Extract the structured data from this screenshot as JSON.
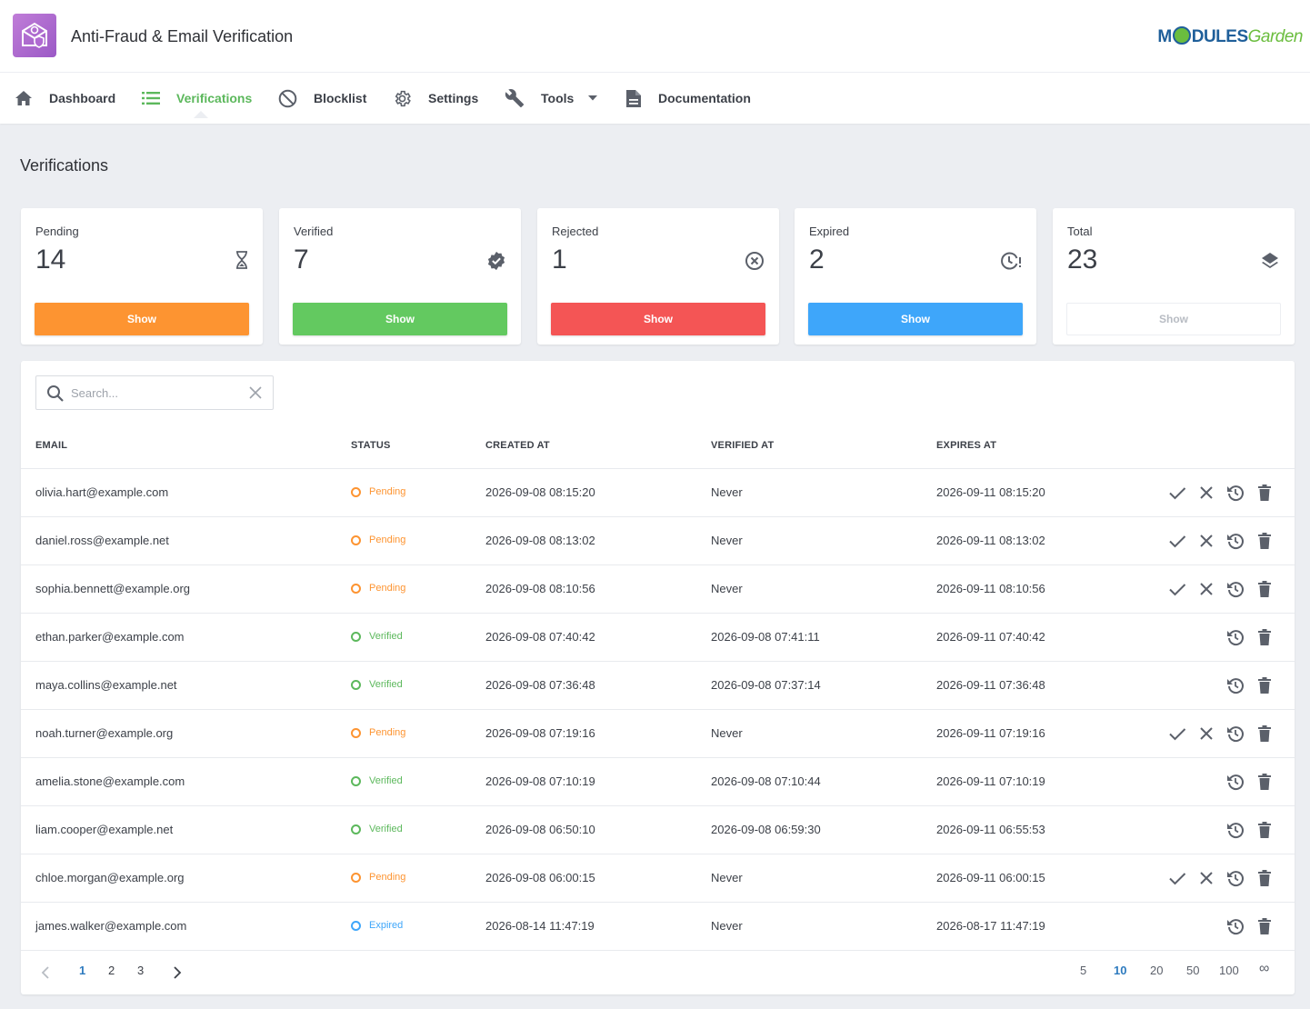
{
  "app": {
    "title": "Anti-Fraud & Email Verification"
  },
  "brand": {
    "part1": "M",
    "part2": "DULES",
    "part3": "Garden"
  },
  "nav": {
    "dashboard": "Dashboard",
    "verifications": "Verifications",
    "blocklist": "Blocklist",
    "settings": "Settings",
    "tools": "Tools",
    "documentation": "Documentation"
  },
  "page": {
    "title": "Verifications"
  },
  "widgets": [
    {
      "label": "Pending",
      "count": "14",
      "button": "Show",
      "color": "#fd9431"
    },
    {
      "label": "Verified",
      "count": "7",
      "button": "Show",
      "color": "#63c960"
    },
    {
      "label": "Rejected",
      "count": "1",
      "button": "Show",
      "color": "#f45555"
    },
    {
      "label": "Expired",
      "count": "2",
      "button": "Show",
      "color": "#3ea6fa"
    },
    {
      "label": "Total",
      "count": "23",
      "button": "Show",
      "color": "#ffffff"
    }
  ],
  "search": {
    "placeholder": "Search...",
    "value": ""
  },
  "table": {
    "headers": {
      "email": "EMAIL",
      "status": "STATUS",
      "created": "CREATED AT",
      "verified": "VERIFIED AT",
      "expires": "EXPIRES AT"
    },
    "status_colors": {
      "Pending": "#fd9431",
      "Verified": "#5cb85c",
      "Expired": "#3ea6fa"
    },
    "rows": [
      {
        "email": "olivia.hart@example.com",
        "status": "Pending",
        "created": "2026-09-08 08:15:20",
        "verified": "Never",
        "expires": "2026-09-11 08:15:20"
      },
      {
        "email": "daniel.ross@example.net",
        "status": "Pending",
        "created": "2026-09-08 08:13:02",
        "verified": "Never",
        "expires": "2026-09-11 08:13:02"
      },
      {
        "email": "sophia.bennett@example.org",
        "status": "Pending",
        "created": "2026-09-08 08:10:56",
        "verified": "Never",
        "expires": "2026-09-11 08:10:56"
      },
      {
        "email": "ethan.parker@example.com",
        "status": "Verified",
        "created": "2026-09-08 07:40:42",
        "verified": "2026-09-08 07:41:11",
        "expires": "2026-09-11 07:40:42"
      },
      {
        "email": "maya.collins@example.net",
        "status": "Verified",
        "created": "2026-09-08 07:36:48",
        "verified": "2026-09-08 07:37:14",
        "expires": "2026-09-11 07:36:48"
      },
      {
        "email": "noah.turner@example.org",
        "status": "Pending",
        "created": "2026-09-08 07:19:16",
        "verified": "Never",
        "expires": "2026-09-11 07:19:16"
      },
      {
        "email": "amelia.stone@example.com",
        "status": "Verified",
        "created": "2026-09-08 07:10:19",
        "verified": "2026-09-08 07:10:44",
        "expires": "2026-09-11 07:10:19"
      },
      {
        "email": "liam.cooper@example.net",
        "status": "Verified",
        "created": "2026-09-08 06:50:10",
        "verified": "2026-09-08 06:59:30",
        "expires": "2026-09-11 06:55:53"
      },
      {
        "email": "chloe.morgan@example.org",
        "status": "Pending",
        "created": "2026-09-08 06:00:15",
        "verified": "Never",
        "expires": "2026-09-11 06:00:15"
      },
      {
        "email": "james.walker@example.com",
        "status": "Expired",
        "created": "2026-08-14 11:47:19",
        "verified": "Never",
        "expires": "2026-08-17 11:47:19"
      }
    ]
  },
  "pagination": {
    "pages": [
      "1",
      "2",
      "3"
    ],
    "current": "1",
    "sizes": [
      "5",
      "10",
      "20",
      "50",
      "100",
      "∞"
    ],
    "current_size": "10"
  }
}
